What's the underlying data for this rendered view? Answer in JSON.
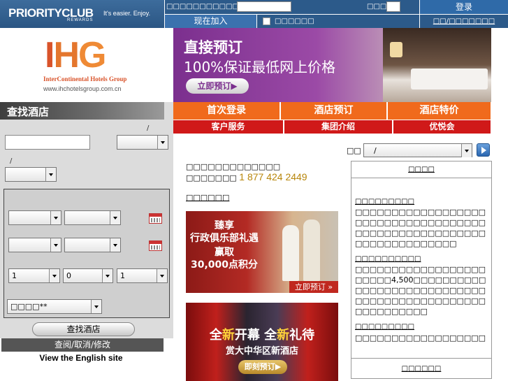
{
  "header": {
    "priority_brand": "PRIORITYCLUB",
    "priority_rewards": "REWARDS",
    "priority_tagline": "It's easier. Enjoy.",
    "member_label": "□□□□□□□□□□□□",
    "pin_label": "□□□□",
    "login_label": "登录",
    "join_now_label": "现在加入",
    "remember_label": "□□□□□□",
    "forgot_label": "□□/□□□□□□□"
  },
  "brand": {
    "ihg_i": "I",
    "ihg_h": "H",
    "ihg_g": "G",
    "fullname": "InterContinental Hotels Group",
    "url": "www.ihchotelsgroup.com.cn"
  },
  "banner": {
    "headline": "直接预订",
    "subline": "100%保证最低网上价格",
    "cta": "立即预订▶"
  },
  "search": {
    "header": "查找酒店",
    "slash1": "/",
    "slash2": "/",
    "rooms_value": "1",
    "adults_value": "0",
    "children_value": "1",
    "rate_value": "□□□□**",
    "button": "查找酒店",
    "manage_booking": "查阅/取消/修改",
    "english_site": "View the English site"
  },
  "nav": {
    "primary": [
      "首次登录",
      "酒店预订",
      "酒店特价"
    ],
    "secondary": [
      "客户服务",
      "集团介绍",
      "优悦会"
    ]
  },
  "language": {
    "label": "□□",
    "selected": "/"
  },
  "reservations": {
    "line1": "□□□□□□□□□□□□□",
    "line2_prefix": "□□□□□□□",
    "phone": "1 877 424 2449",
    "more": "□□□□□□"
  },
  "promos": {
    "club_l1": "臻享",
    "club_l2": "行政俱乐部礼遇",
    "club_l3": "赢取",
    "club_l4": "30,000点积分",
    "club_cta": "立即预订 »",
    "china_a": "全",
    "china_b": "新",
    "china_c": "开幕 全",
    "china_d": "新",
    "china_e": "礼待",
    "china_l2": "赏大中华区新酒店",
    "china_cta": "即刻预订▶"
  },
  "news": {
    "header": "□□□□",
    "items": [
      {
        "title": "□□□□□□□□□",
        "body": "□□□□□□□□□□□□□□□□□□□□□□□□□□□□□□□□□□□□□□□□□□□□□□□□□□□□□□□□□□□□□□□□□□□□"
      },
      {
        "title": "□□□□□□□□□□",
        "body": "□□□□□□□□□□□□□□□□□□□□□□□4,500□□□□□□□□□□□□□□□□□□□□□□□□□□□□□□□□□□□□□□□□□□□□□□□□□□□□□□□□"
      },
      {
        "title": "□□□□□□□□□",
        "body": "□□□□□□□□□□□□□□□□□□"
      }
    ],
    "footer": "□□□□□□"
  }
}
